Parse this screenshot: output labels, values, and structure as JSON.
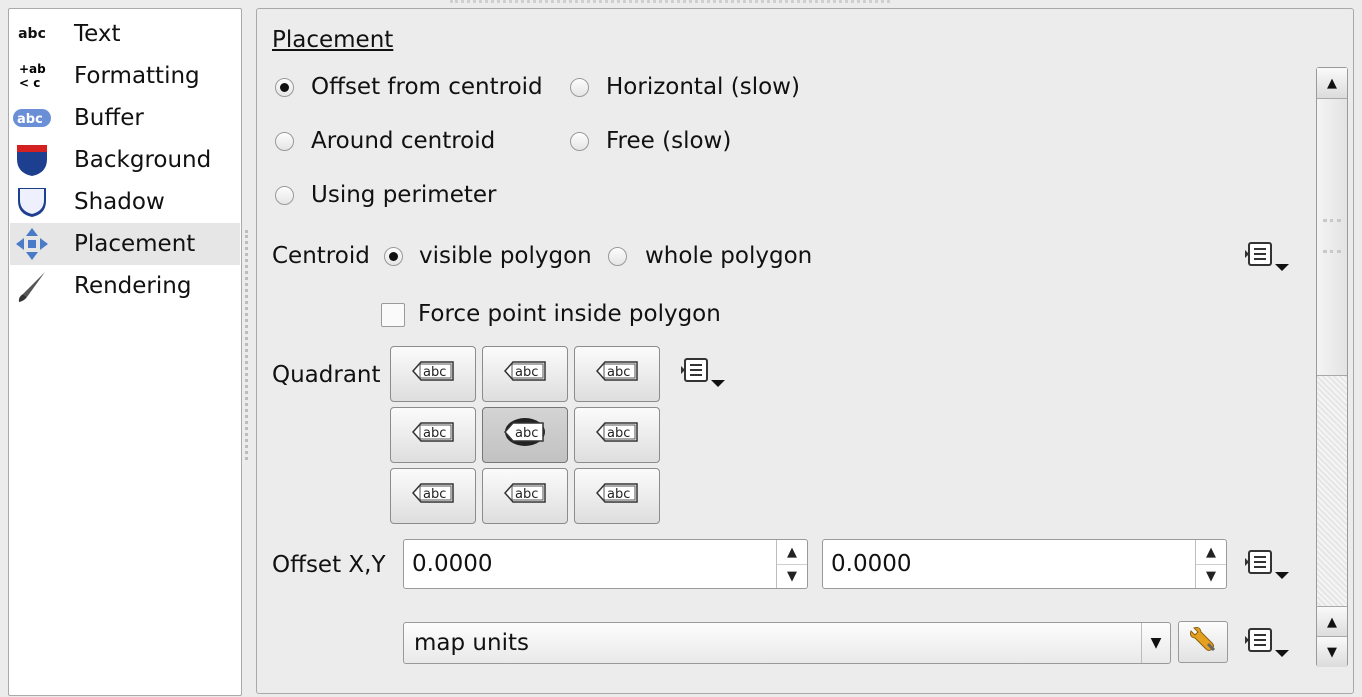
{
  "sidebar": {
    "items": [
      {
        "label": "Text",
        "icon": "abc-text-icon"
      },
      {
        "label": "Formatting",
        "icon": "formatting-icon"
      },
      {
        "label": "Buffer",
        "icon": "buffer-icon"
      },
      {
        "label": "Background",
        "icon": "background-shield-icon"
      },
      {
        "label": "Shadow",
        "icon": "shadow-shield-icon"
      },
      {
        "label": "Placement",
        "icon": "placement-arrows-icon",
        "selected": true
      },
      {
        "label": "Rendering",
        "icon": "rendering-brush-icon"
      }
    ]
  },
  "placement": {
    "heading": "Placement",
    "radios": {
      "offset_from_centroid": {
        "label": "Offset from centroid",
        "checked": true
      },
      "horizontal_slow": {
        "label": "Horizontal (slow)",
        "checked": false
      },
      "around_centroid": {
        "label": "Around centroid",
        "checked": false
      },
      "free_slow": {
        "label": "Free (slow)",
        "checked": false
      },
      "using_perimeter": {
        "label": "Using perimeter",
        "checked": false
      }
    },
    "centroid": {
      "label": "Centroid",
      "visible_polygon": "visible polygon",
      "whole_polygon": "whole polygon",
      "selected": "visible polygon"
    },
    "force_point": {
      "label": "Force point inside polygon",
      "checked": false
    },
    "quadrant": {
      "label": "Quadrant",
      "button_text": "abc",
      "selected": "center"
    },
    "offset": {
      "label": "Offset X,Y",
      "x": "0.0000",
      "y": "0.0000"
    },
    "units": {
      "value": "map units"
    }
  },
  "icons": {
    "data_defined": "data-defined-override-icon",
    "units_settings": "wrench-icon"
  }
}
